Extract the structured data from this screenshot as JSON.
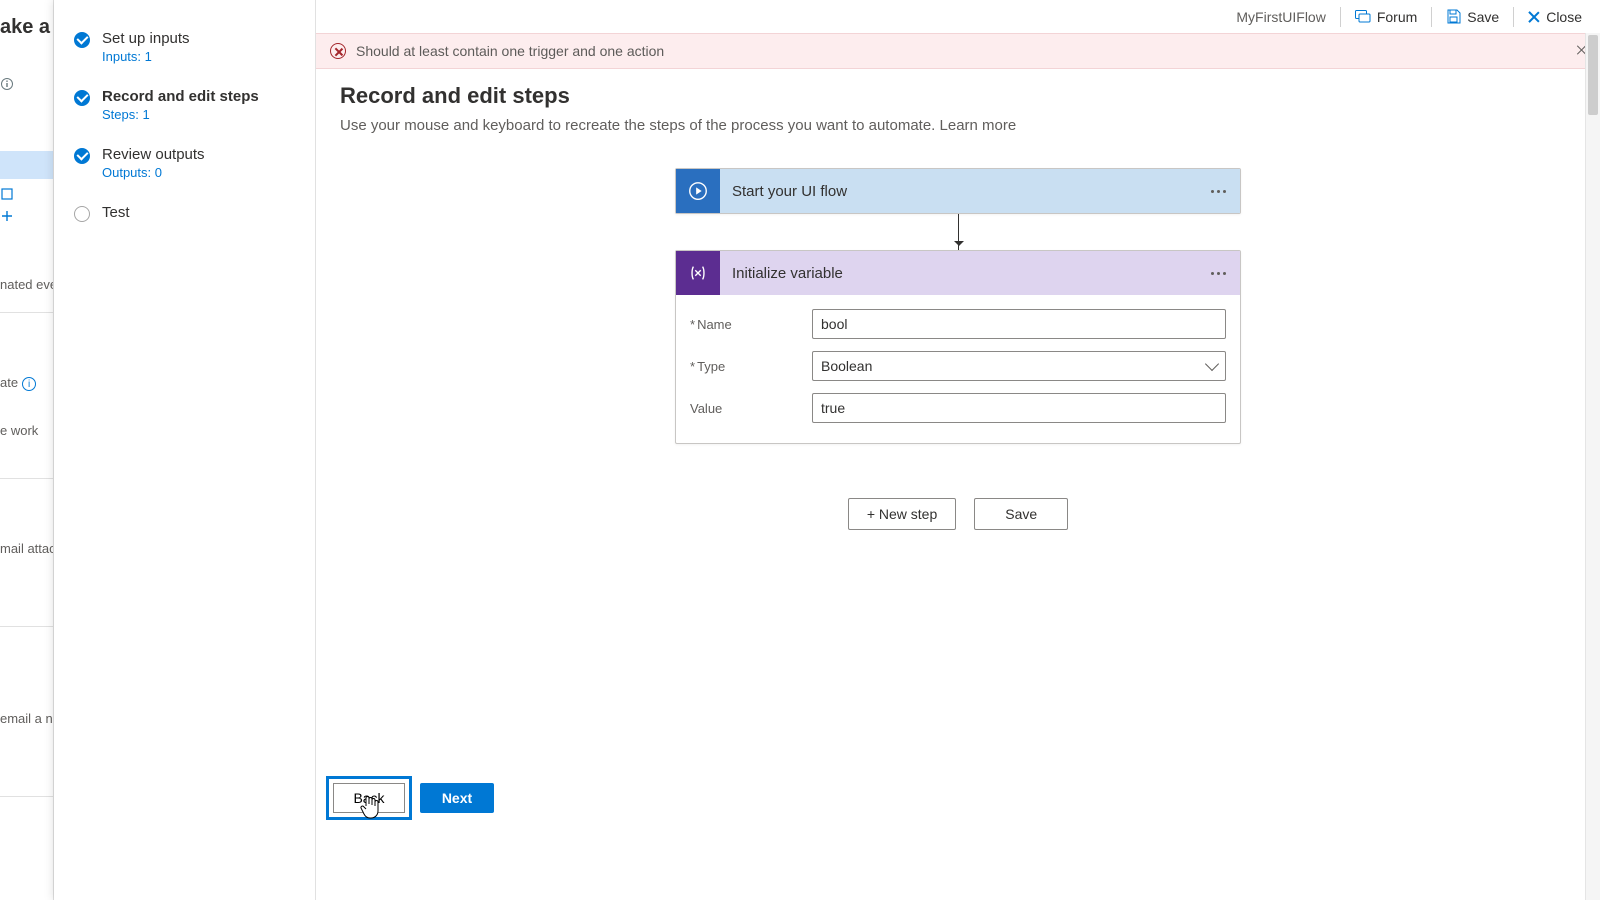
{
  "topbar": {
    "flow_name": "MyFirstUIFlow",
    "forum": "Forum",
    "save": "Save",
    "close": "Close"
  },
  "banner": {
    "message": "Should at least contain one trigger and one action"
  },
  "wizard": {
    "steps": [
      {
        "title": "Set up inputs",
        "sub": "Inputs: 1",
        "done": true,
        "active": false
      },
      {
        "title": "Record and edit steps",
        "sub": "Steps: 1",
        "done": true,
        "active": true
      },
      {
        "title": "Review outputs",
        "sub": "Outputs: 0",
        "done": true,
        "active": false
      },
      {
        "title": "Test",
        "sub": "",
        "done": false,
        "active": false
      }
    ]
  },
  "page": {
    "title": "Record and edit steps",
    "desc": "Use your mouse and keyboard to recreate the steps of the process you want to automate.  ",
    "learn": "Learn more"
  },
  "flow": {
    "start_card_title": "Start your UI flow",
    "var_card_title": "Initialize variable",
    "fields": {
      "name_label": "Name",
      "name_value": "bool",
      "type_label": "Type",
      "type_value": "Boolean",
      "value_label": "Value",
      "value_value": "true"
    },
    "new_step": "+ New step",
    "save": "Save"
  },
  "footer": {
    "back": "Back",
    "next": "Next"
  },
  "bg": {
    "title": "ake a fl",
    "item1": "nated even",
    "item2": "ate",
    "item3": "e work",
    "item4": "mail attac",
    "item5": "email a n"
  }
}
